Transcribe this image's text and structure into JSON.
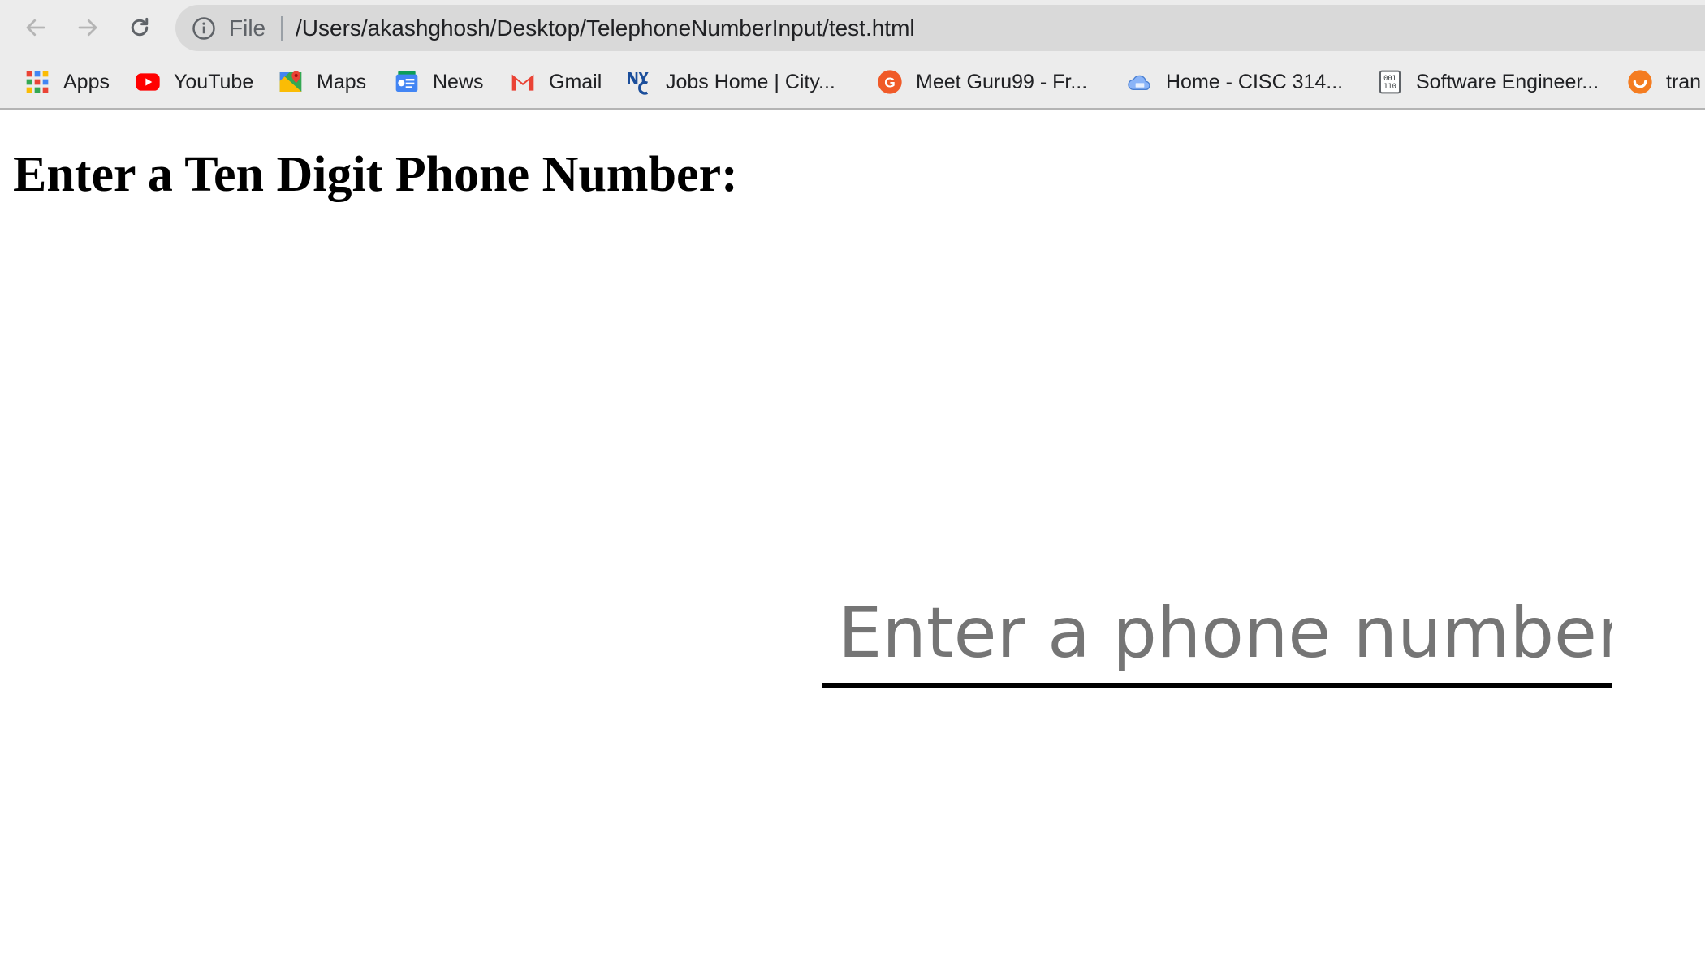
{
  "browser": {
    "omnibox": {
      "scheme_label": "File",
      "url": "/Users/akashghosh/Desktop/TelephoneNumberInput/test.html"
    },
    "bookmarks": [
      {
        "label": "Apps",
        "icon": "apps-grid-icon"
      },
      {
        "label": "YouTube",
        "icon": "youtube-icon"
      },
      {
        "label": "Maps",
        "icon": "maps-icon"
      },
      {
        "label": "News",
        "icon": "google-news-icon"
      },
      {
        "label": "Gmail",
        "icon": "gmail-icon"
      },
      {
        "label": "Jobs Home | City...",
        "icon": "nyc-icon"
      },
      {
        "label": "Meet Guru99 - Fr...",
        "icon": "guru99-icon"
      },
      {
        "label": "Home - CISC 314...",
        "icon": "cloud-icon"
      },
      {
        "label": "Software Engineer...",
        "icon": "binary-doc-icon"
      },
      {
        "label": "tran",
        "icon": "orange-smile-icon"
      }
    ]
  },
  "page": {
    "heading": "Enter a Ten Digit Phone Number:",
    "phone_input": {
      "placeholder": "Enter a phone number",
      "value": ""
    }
  },
  "colors": {
    "toolbar_bg": "#ececec",
    "omnibox_bg": "#d9d9d9",
    "placeholder": "#757575",
    "input_underline": "#000000"
  }
}
